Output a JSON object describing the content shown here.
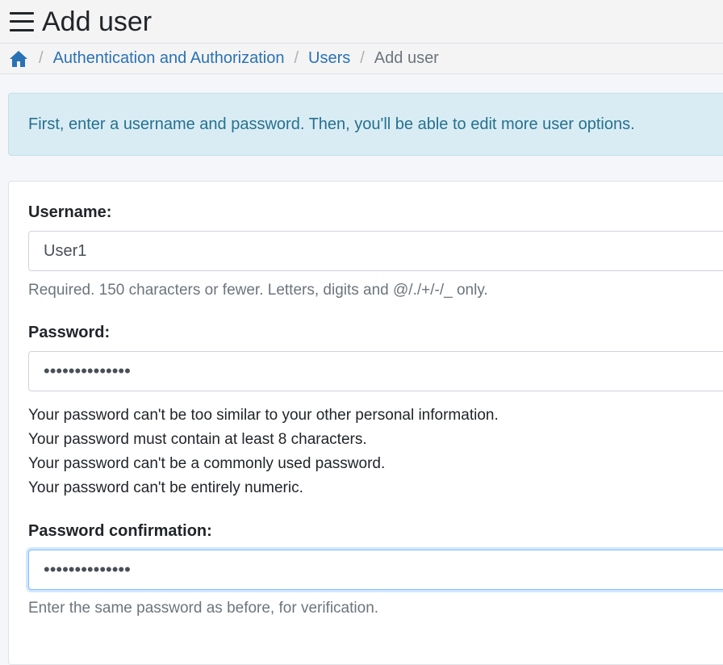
{
  "header": {
    "title": "Add user"
  },
  "breadcrumb": {
    "items": [
      "Authentication and Authorization",
      "Users"
    ],
    "current": "Add user",
    "separator": "/"
  },
  "alert": {
    "text": "First, enter a username and password. Then, you'll be able to edit more user options."
  },
  "form": {
    "username": {
      "label": "Username:",
      "value": "User1",
      "help": "Required. 150 characters or fewer. Letters, digits and @/./+/-/_ only."
    },
    "password": {
      "label": "Password:",
      "value": "••••••••••••••",
      "help": [
        "Your password can't be too similar to your other personal information.",
        "Your password must contain at least 8 characters.",
        "Your password can't be a commonly used password.",
        "Your password can't be entirely numeric."
      ]
    },
    "password_confirmation": {
      "label": "Password confirmation:",
      "value": "••••••••••••••",
      "help": "Enter the same password as before, for verification."
    }
  },
  "colors": {
    "link": "#2a72b5",
    "alert_bg": "#d9ecf4",
    "alert_text": "#26718f",
    "focus_border": "#80bdff"
  },
  "icons": {
    "menu": "hamburger-menu-icon",
    "home": "home-icon"
  }
}
